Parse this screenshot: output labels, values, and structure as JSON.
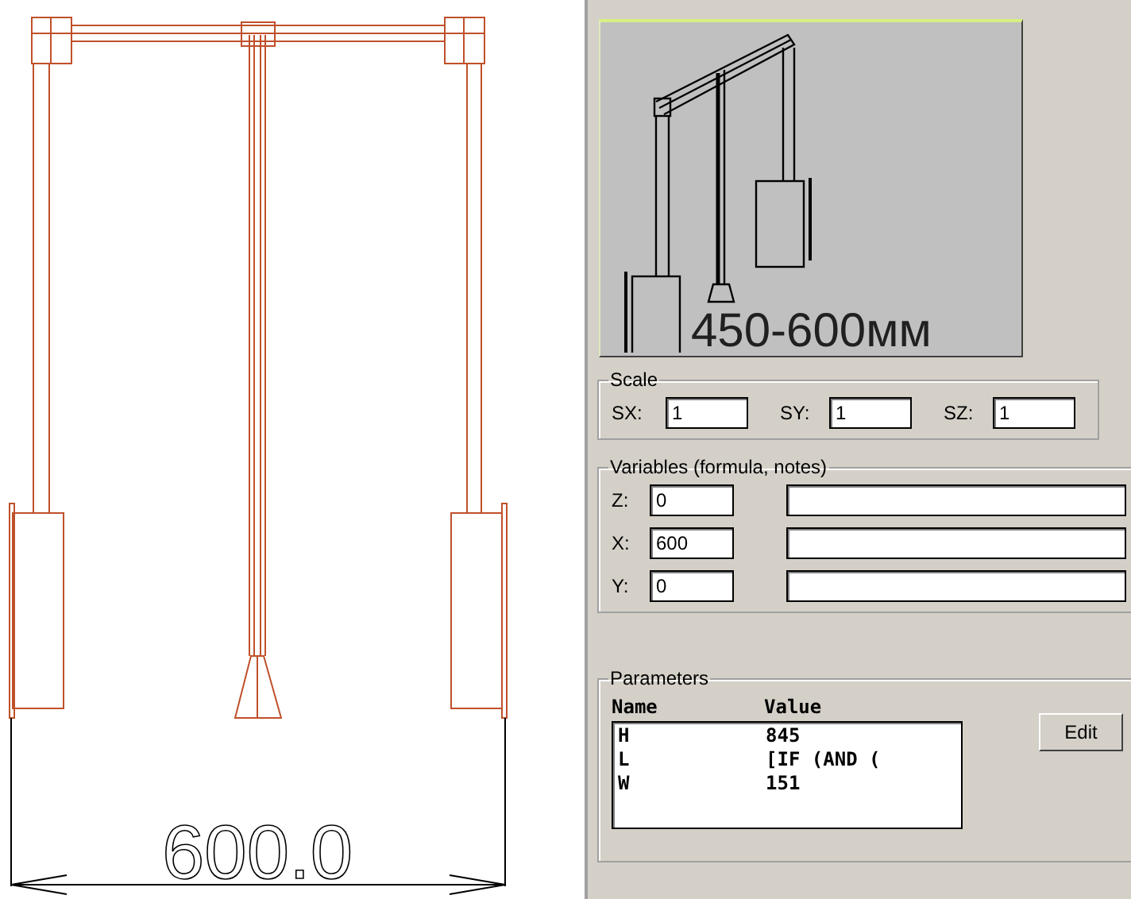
{
  "drawing": {
    "dimension": "600.0"
  },
  "preview": {
    "caption": "450-600мм"
  },
  "scale": {
    "title": "Scale",
    "fields": [
      {
        "label": "SX:",
        "value": "1"
      },
      {
        "label": "SY:",
        "value": "1"
      },
      {
        "label": "SZ:",
        "value": "1"
      }
    ]
  },
  "variables": {
    "title": "Variables (formula, notes)",
    "rows": [
      {
        "label": "Z:",
        "value": "0"
      },
      {
        "label": "X:",
        "value": "600"
      },
      {
        "label": "Y:",
        "value": "0"
      }
    ]
  },
  "parameters": {
    "title": "Parameters",
    "columns": [
      "Name",
      "Value"
    ],
    "rows": [
      {
        "name": "H",
        "value": "845"
      },
      {
        "name": "L",
        "value": "[IF (AND ("
      },
      {
        "name": "W",
        "value": "151"
      }
    ],
    "button": "Edit"
  }
}
